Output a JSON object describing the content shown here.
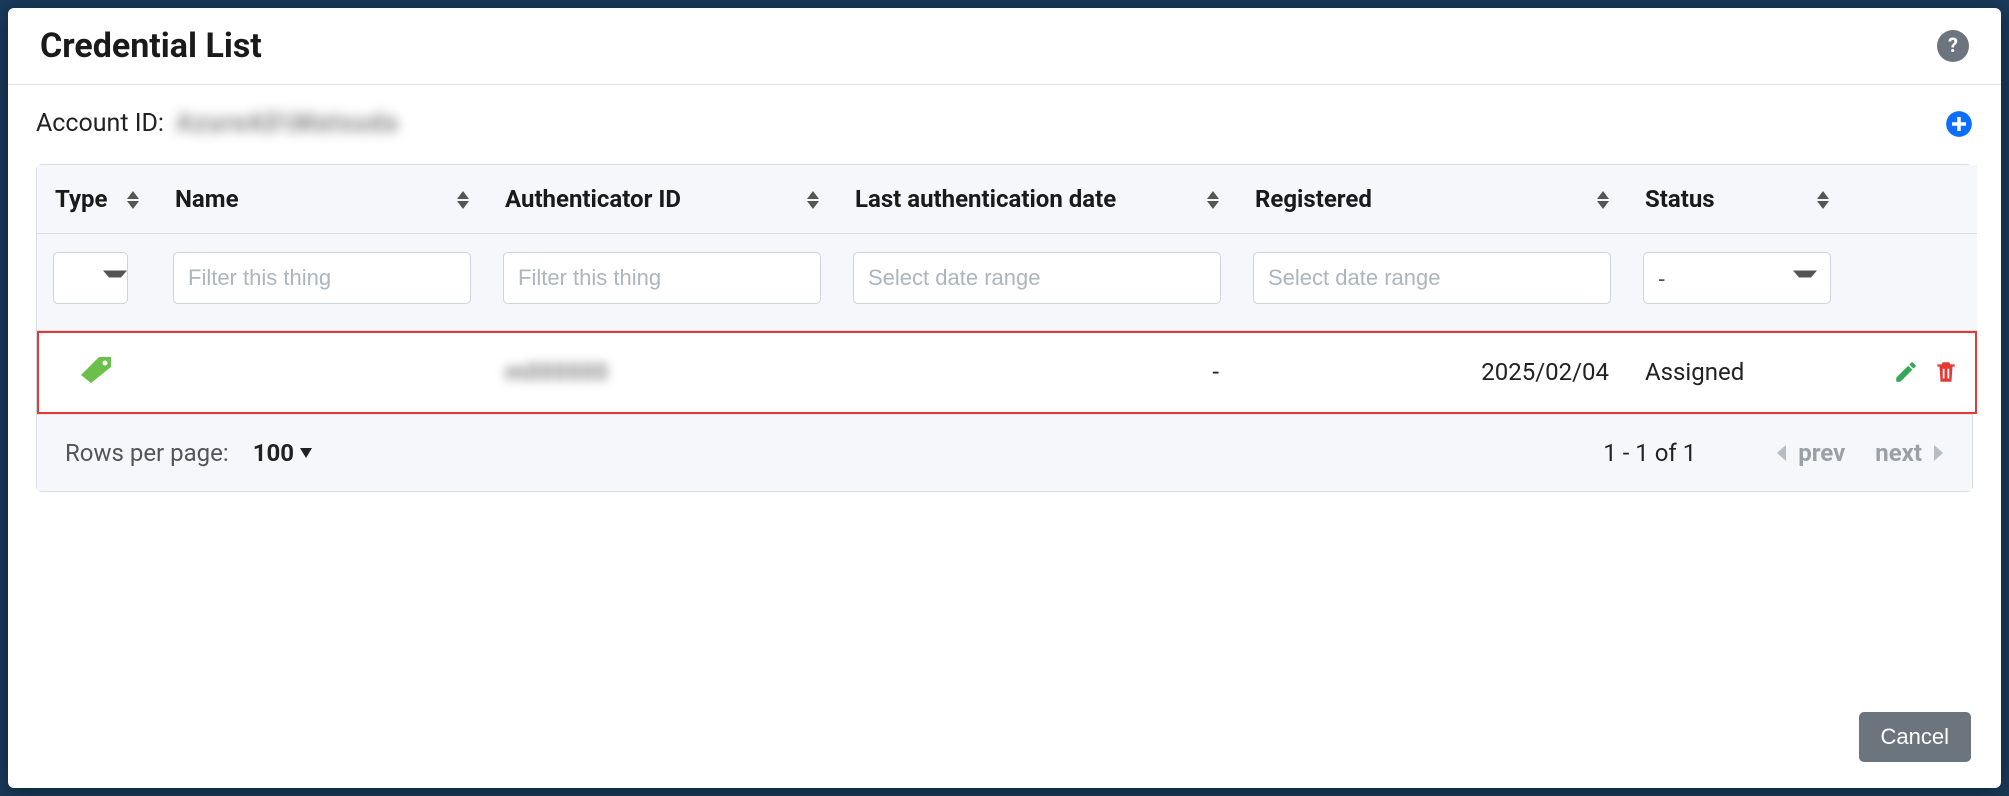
{
  "modal": {
    "title": "Credential List",
    "account_id_label": "Account ID:",
    "account_id_value": "AzureAD\\Matsuda",
    "cancel_label": "Cancel"
  },
  "icons": {
    "help": "help-circle-icon",
    "add": "plus-circle-icon",
    "type": "tag-icon",
    "edit": "edit-icon",
    "delete": "trash-icon",
    "sort_up": "caret-up-icon",
    "sort_down": "caret-down-icon"
  },
  "colors": {
    "help_bg": "#6c757d",
    "add": "#0d6efd",
    "tag": "#4caf50",
    "edit": "#4caf50",
    "delete": "#e53935",
    "highlight_border": "#e53935"
  },
  "table": {
    "headers": {
      "type": "Type",
      "name": "Name",
      "authenticator_id": "Authenticator ID",
      "last_auth": "Last authentication date",
      "registered": "Registered",
      "status": "Status"
    },
    "filters": {
      "name_placeholder": "Filter this thing",
      "authid_placeholder": "Filter this thing",
      "last_auth_placeholder": "Select date range",
      "registered_placeholder": "Select date range",
      "status_default": "-"
    },
    "rows": [
      {
        "type_icon": "tag-icon",
        "name": "",
        "authenticator_id": "m000000",
        "last_auth": "-",
        "registered": "2025/02/04",
        "status": "Assigned",
        "highlighted": true
      }
    ]
  },
  "pager": {
    "rows_per_page_label": "Rows per page:",
    "rows_per_page_value": "100",
    "range_text": "1 - 1 of 1",
    "prev_label": "prev",
    "next_label": "next"
  }
}
